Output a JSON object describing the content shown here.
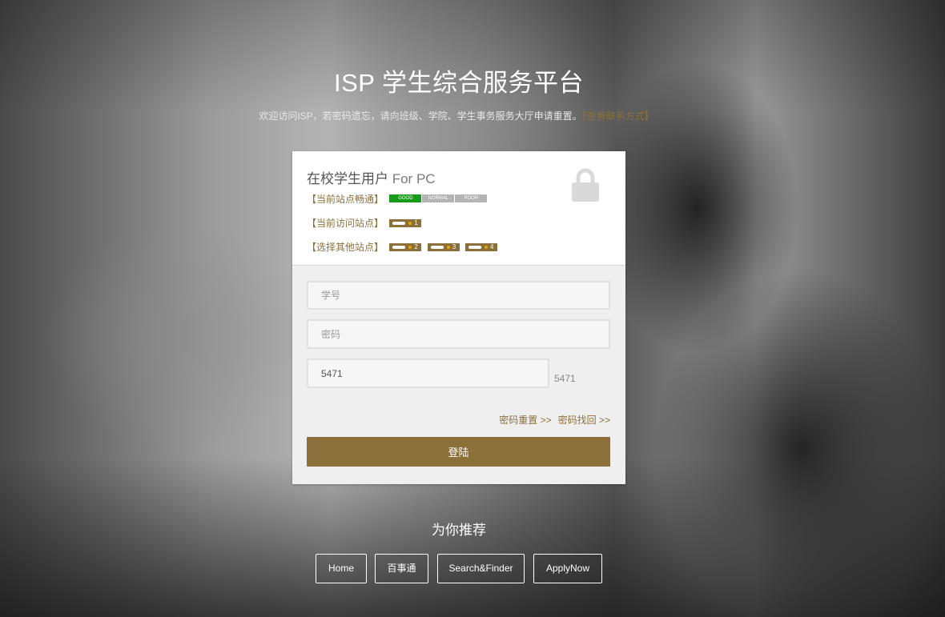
{
  "header": {
    "title": "ISP 学生综合服务平台",
    "subtitle": "欢迎访问ISP，若密码遗忘，请向班级、学院、学生事务服务大厅申请重置。",
    "contact_link": "【查看联系方式】"
  },
  "card": {
    "heading_cn": "在校学生用户",
    "heading_en": " For PC",
    "status_label": "【当前站点畅通】",
    "quality_levels": [
      "GOOD",
      "NORMAL",
      "POOR"
    ],
    "current_quality": "GOOD",
    "current_site_label": "【当前访问站点】",
    "other_sites_label": "【选择其他站点】",
    "current_site": "1",
    "other_sites": [
      "2",
      "3",
      "4"
    ]
  },
  "form": {
    "username_placeholder": "学号",
    "password_placeholder": "密码",
    "captcha_value": "5471",
    "captcha_image_text": "5471",
    "reset_link": "密码重置 >>",
    "recover_link": "密码找回 >>",
    "login_label": "登陆"
  },
  "recommend": {
    "title": "为你推荐",
    "buttons": [
      "Home",
      "百事通",
      "Search&Finder",
      "ApplyNow"
    ]
  },
  "colors": {
    "accent": "#8b7039",
    "good": "#179b1a",
    "inactive": "#b4b4b4"
  },
  "icons": {
    "lock": "lock-icon"
  }
}
